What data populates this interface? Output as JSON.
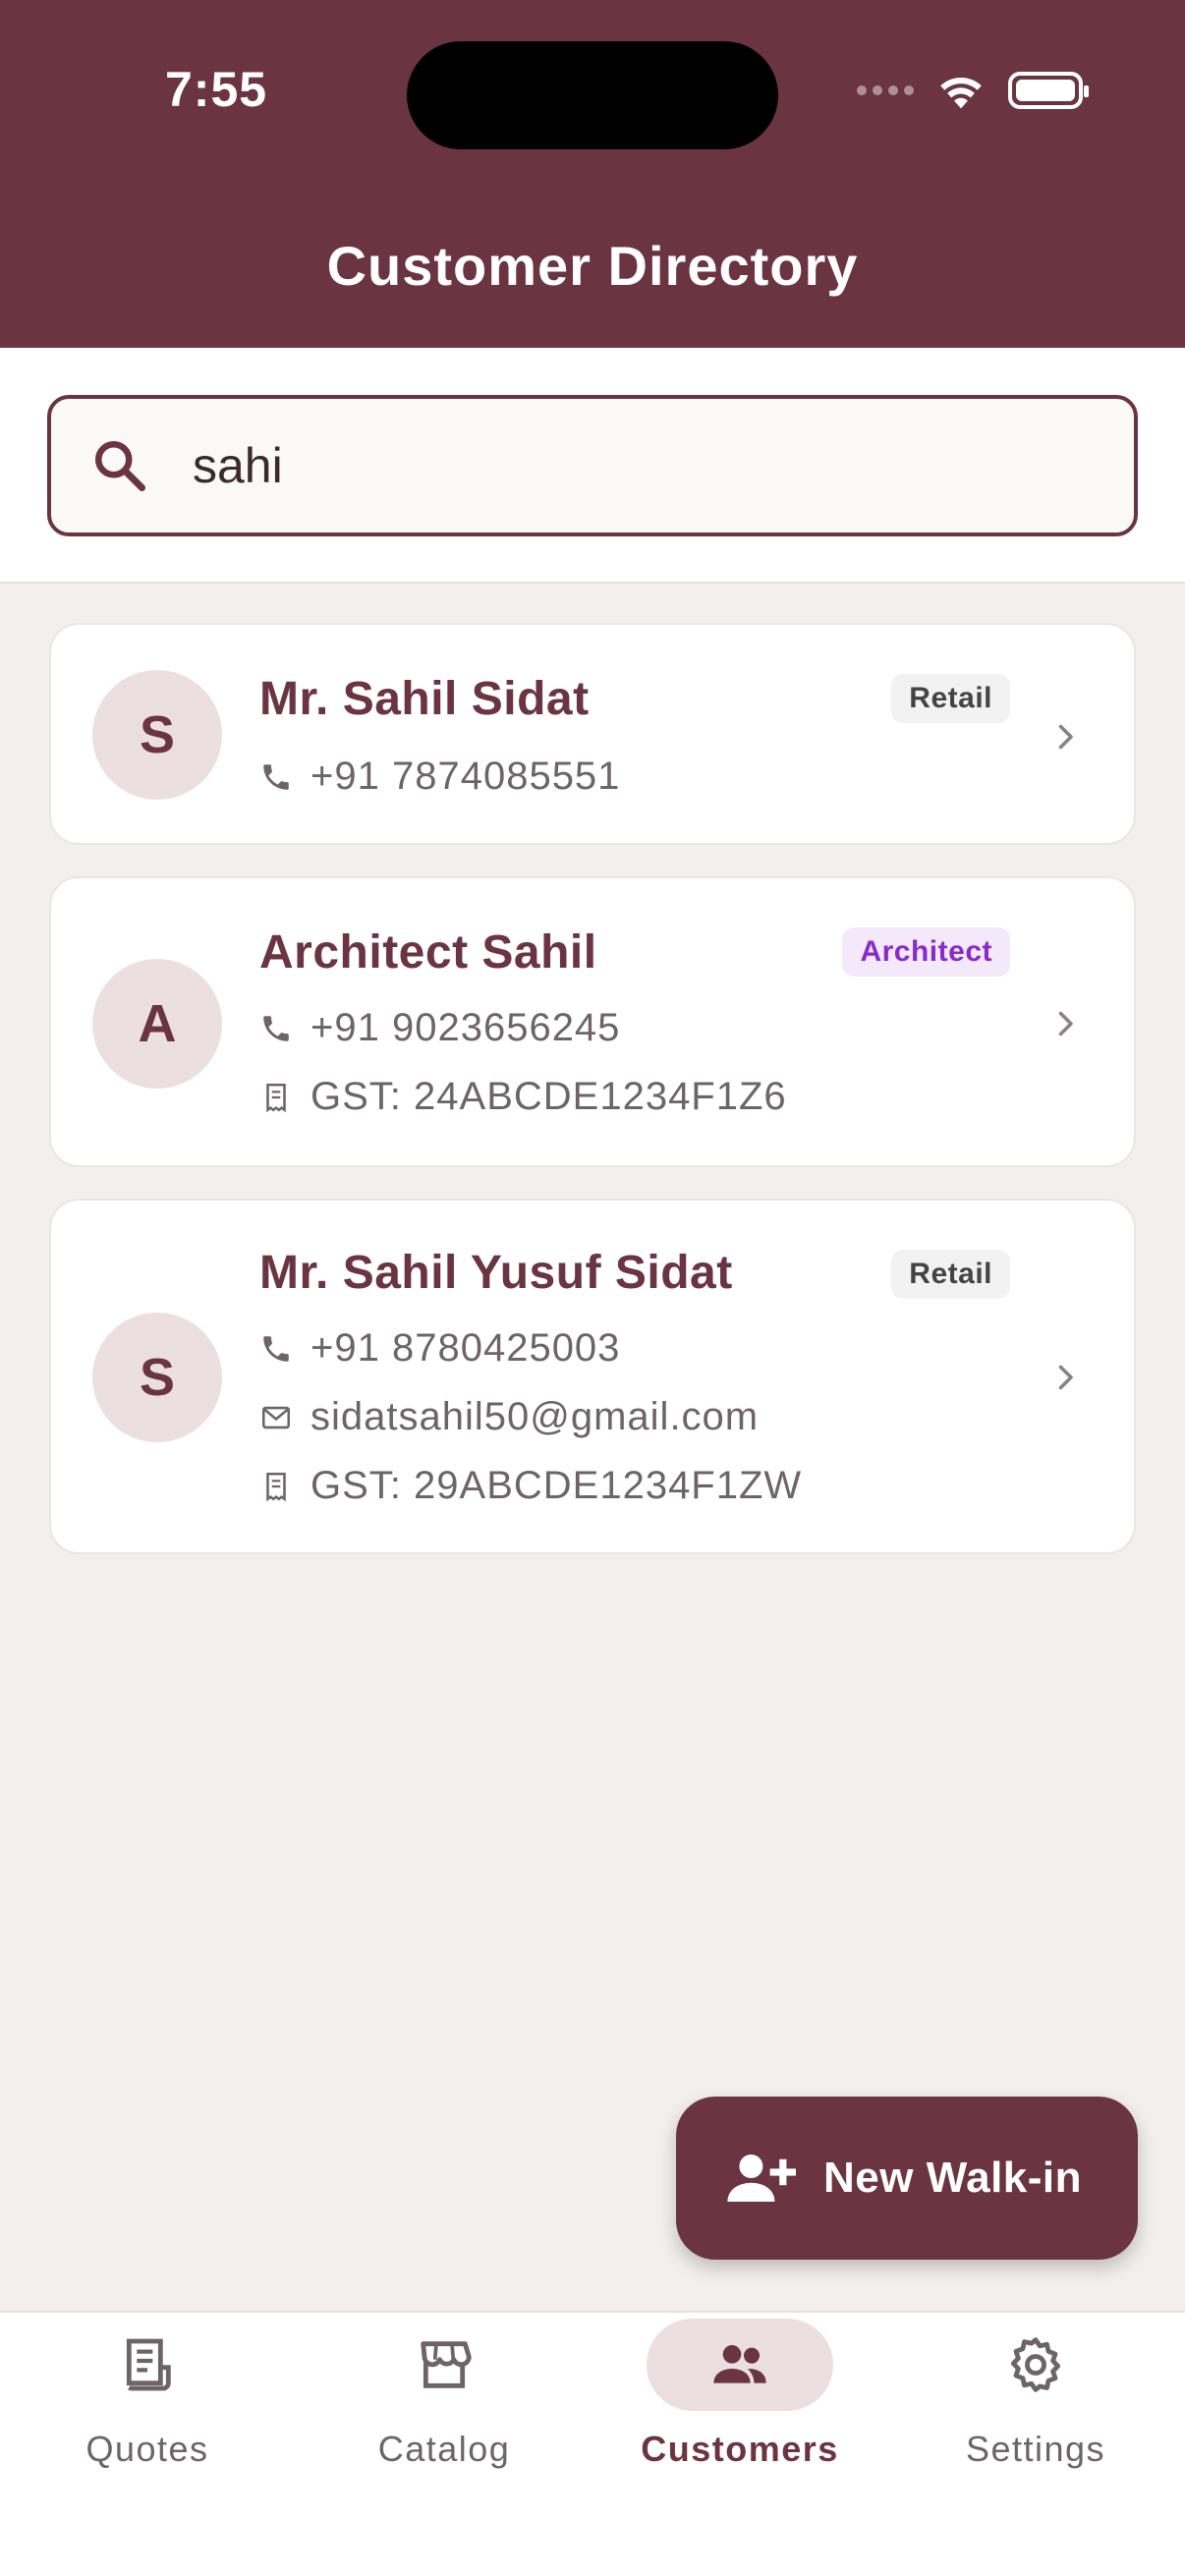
{
  "status_bar": {
    "time": "7:55"
  },
  "header": {
    "title": "Customer Directory"
  },
  "search": {
    "value": "sahi",
    "placeholder": ""
  },
  "customers": [
    {
      "initial": "S",
      "name": "Mr. Sahil Sidat",
      "badge": "Retail",
      "phone": "+91 7874085551"
    },
    {
      "initial": "A",
      "name": "Architect Sahil",
      "badge": "Architect",
      "phone": "+91 9023656245",
      "gst": "GST: 24ABCDE1234F1Z6"
    },
    {
      "initial": "S",
      "name": "Mr. Sahil Yusuf Sidat",
      "badge": "Retail",
      "phone": "+91 8780425003",
      "email": "sidatsahil50@gmail.com",
      "gst": "GST: 29ABCDE1234F1ZW"
    }
  ],
  "fab": {
    "label": "New Walk-in"
  },
  "nav": {
    "items": [
      {
        "label": "Quotes",
        "icon": "receipt-icon"
      },
      {
        "label": "Catalog",
        "icon": "storefront-icon"
      },
      {
        "label": "Customers",
        "icon": "people-icon",
        "active": true
      },
      {
        "label": "Settings",
        "icon": "gear-icon"
      }
    ]
  },
  "colors": {
    "brand": "#6B3441",
    "background": "#F3EFEC",
    "architect_badge": "#8A2BC9"
  }
}
